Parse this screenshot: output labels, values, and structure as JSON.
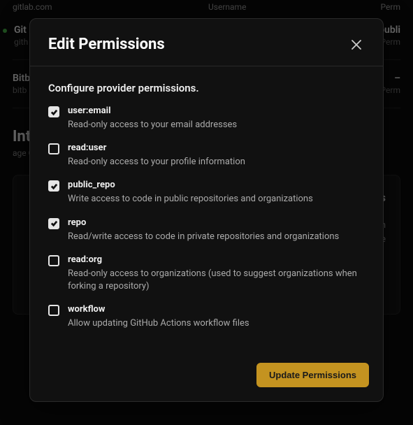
{
  "background": {
    "header": {
      "col1": "gitlab.com",
      "col2": "Username",
      "col3": "Perm"
    },
    "rows": [
      {
        "title": "Git",
        "sub": "gith",
        "right_top": "publi",
        "right_sub": "Perm",
        "dot": true
      },
      {
        "title": "Bitb",
        "sub": "bitb",
        "right_top": "–",
        "right_sub": "Perm",
        "dot": false
      }
    ],
    "section_title": "Int",
    "section_sub": "age G",
    "card_title": "s",
    "card_line1": "u can",
    "card_line2": "ovide"
  },
  "modal": {
    "title": "Edit Permissions",
    "configure_text": "Configure provider permissions.",
    "permissions": [
      {
        "label": "user:email",
        "desc": "Read-only access to your email addresses",
        "checked": true
      },
      {
        "label": "read:user",
        "desc": "Read-only access to your profile information",
        "checked": false
      },
      {
        "label": "public_repo",
        "desc": "Write access to code in public repositories and organizations",
        "checked": true
      },
      {
        "label": "repo",
        "desc": "Read/write access to code in private repositories and organizations",
        "checked": true
      },
      {
        "label": "read:org",
        "desc": "Read-only access to organizations (used to suggest organizations when forking a repository)",
        "checked": false
      },
      {
        "label": "workflow",
        "desc": "Allow updating GitHub Actions workflow files",
        "checked": false
      }
    ],
    "update_button": "Update Permissions"
  }
}
